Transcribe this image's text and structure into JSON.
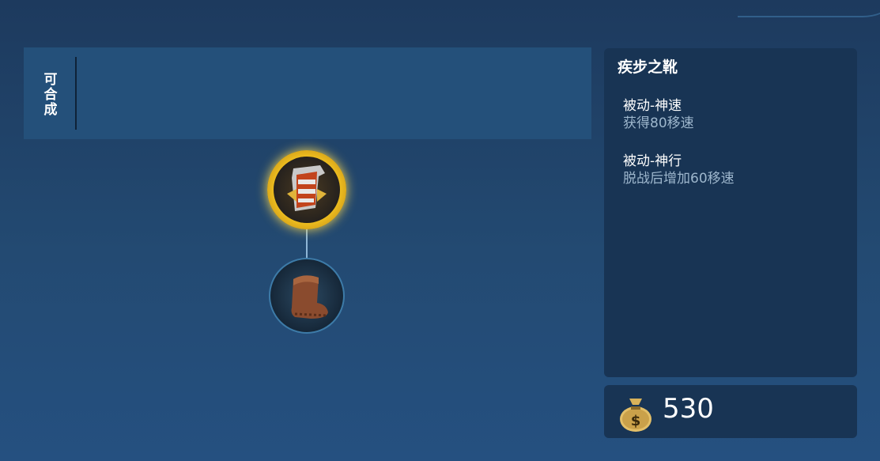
{
  "combinable": {
    "label": "可合成"
  },
  "tree": {
    "selected_item": {
      "icon": "gold-boots-icon",
      "selected": true
    },
    "base_item": {
      "icon": "leather-boots-icon"
    }
  },
  "detail": {
    "name": "疾步之靴",
    "effects": [
      {
        "title": "被动-神速",
        "desc": "获得80移速"
      },
      {
        "title": "被动-神行",
        "desc": "脱战后增加60移速"
      }
    ]
  },
  "price": {
    "icon": "gold-coin-bag-icon",
    "value": "530"
  },
  "colors": {
    "selected_ring": "#f3c320",
    "panel_bg": "#183454",
    "accent_blue": "#3d7ba8"
  }
}
